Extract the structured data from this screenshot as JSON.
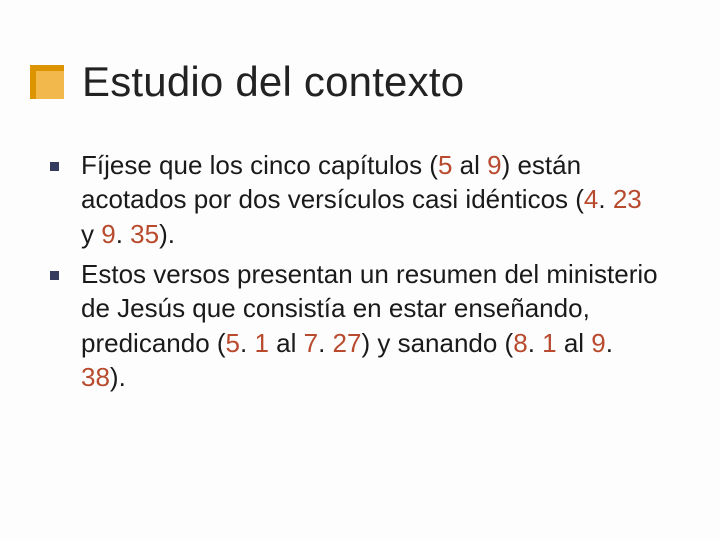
{
  "title": "Estudio del contexto",
  "bullets": [
    {
      "segments": [
        {
          "t": "Fíjese que los cinco capítulos (",
          "n": false
        },
        {
          "t": "5 ",
          "n": true
        },
        {
          "t": "al ",
          "n": false
        },
        {
          "t": "9",
          "n": true
        },
        {
          "t": ") están acotados por dos versículos casi idénticos (",
          "n": false
        },
        {
          "t": "4",
          "n": true
        },
        {
          "t": ". ",
          "n": false
        },
        {
          "t": "23 ",
          "n": true
        },
        {
          "t": "y ",
          "n": false
        },
        {
          "t": "9",
          "n": true
        },
        {
          "t": ". ",
          "n": false
        },
        {
          "t": "35",
          "n": true
        },
        {
          "t": ").",
          "n": false
        }
      ]
    },
    {
      "segments": [
        {
          "t": "Estos versos presentan un resumen del ministerio de Jesús que consistía en estar enseñando, predicando (",
          "n": false
        },
        {
          "t": "5",
          "n": true
        },
        {
          "t": ". ",
          "n": false
        },
        {
          "t": "1 ",
          "n": true
        },
        {
          "t": "al ",
          "n": false
        },
        {
          "t": "7",
          "n": true
        },
        {
          "t": ". ",
          "n": false
        },
        {
          "t": "27",
          "n": true
        },
        {
          "t": ") y sanando (",
          "n": false
        },
        {
          "t": "8",
          "n": true
        },
        {
          "t": ". ",
          "n": false
        },
        {
          "t": "1 ",
          "n": true
        },
        {
          "t": "al ",
          "n": false
        },
        {
          "t": "9",
          "n": true
        },
        {
          "t": ". ",
          "n": false
        },
        {
          "t": "38",
          "n": true
        },
        {
          "t": ").",
          "n": false
        }
      ]
    }
  ]
}
